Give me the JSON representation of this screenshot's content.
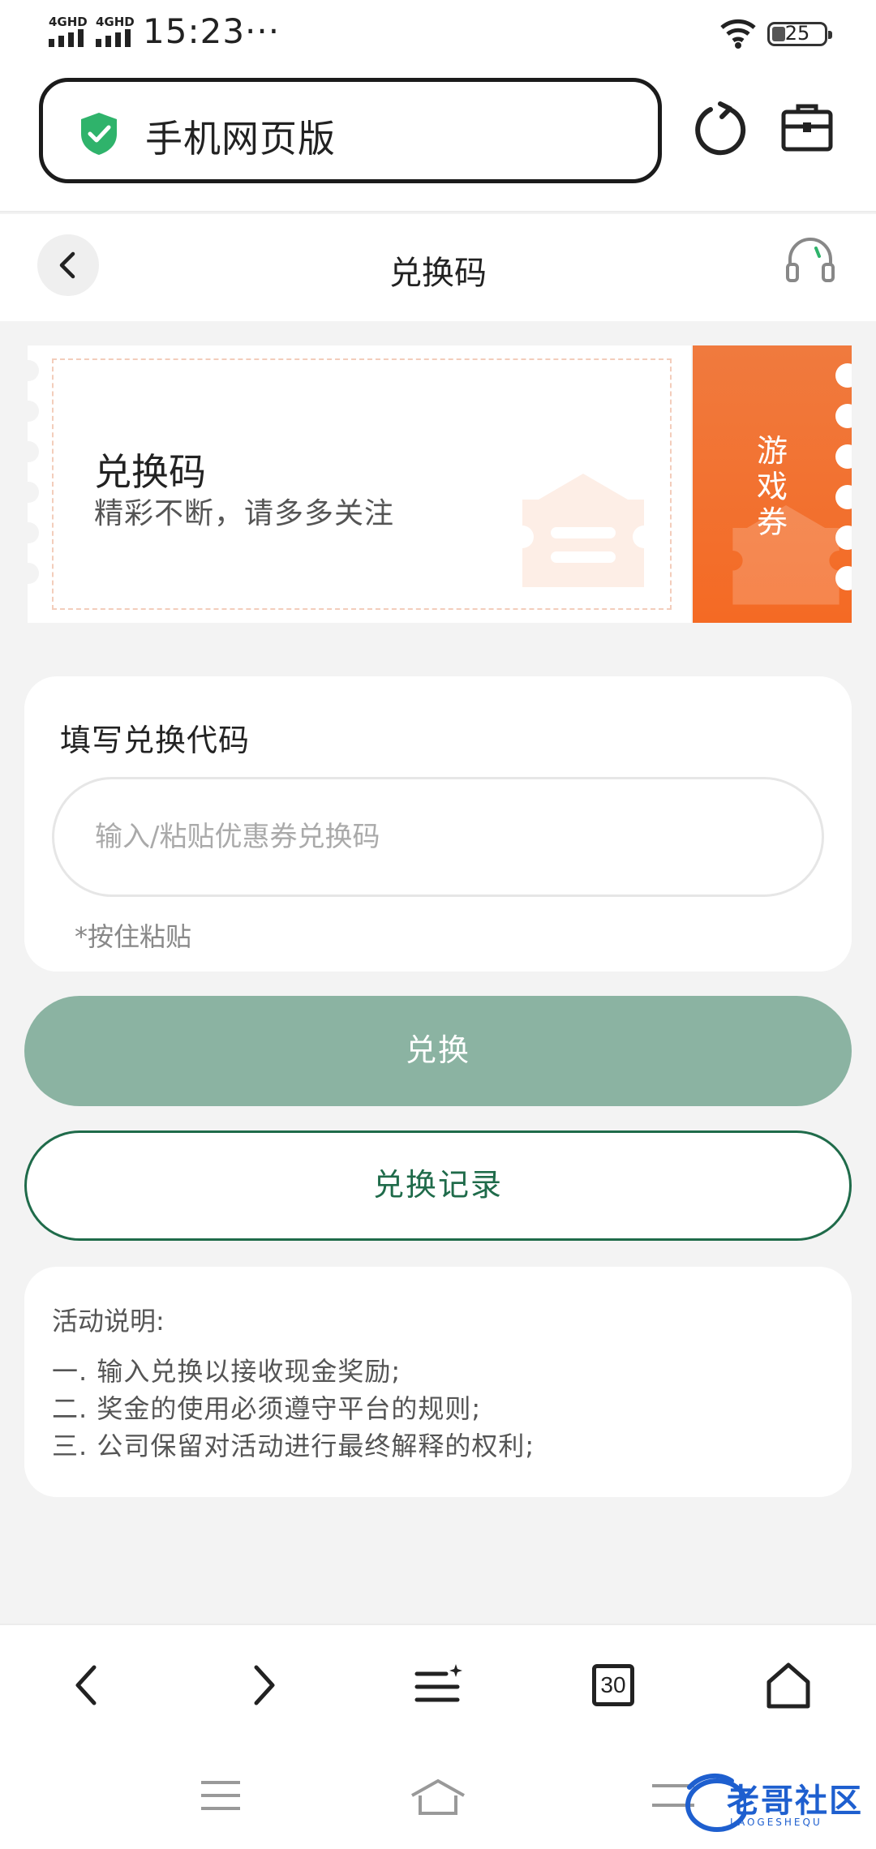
{
  "status_bar": {
    "signal_1": "4GHD",
    "signal_2": "4GHD",
    "time": "15:23",
    "more": "···",
    "battery": "25"
  },
  "browser": {
    "url_text": "手机网页版",
    "tab_count": "30"
  },
  "header": {
    "title": "兑换码"
  },
  "coupon": {
    "title": "兑换码",
    "subtitle": "精彩不断，请多多关注",
    "stub_text": [
      "游",
      "戏",
      "券"
    ],
    "accent": "#f46a24"
  },
  "form": {
    "label": "填写兑换代码",
    "placeholder": "输入/粘贴优惠券兑换码",
    "value": "",
    "hint": "*按住粘贴"
  },
  "buttons": {
    "redeem": "兑换",
    "history": "兑换记录"
  },
  "rules": {
    "title": "活动说明:",
    "items": [
      "一. 输入兑换以接收现金奖励;",
      "二. 奖金的使用必须遵守平台的规则;",
      "三. 公司保留对活动进行最终解释的权利;"
    ]
  },
  "watermark_logo": {
    "text": "老哥社区",
    "sub": "LAOGESHEQU"
  },
  "colors": {
    "primary_green": "#8bb3a2",
    "outline_green": "#1f6b4a",
    "shield_green": "#2fb36b",
    "coupon_orange": "#f46a24"
  }
}
